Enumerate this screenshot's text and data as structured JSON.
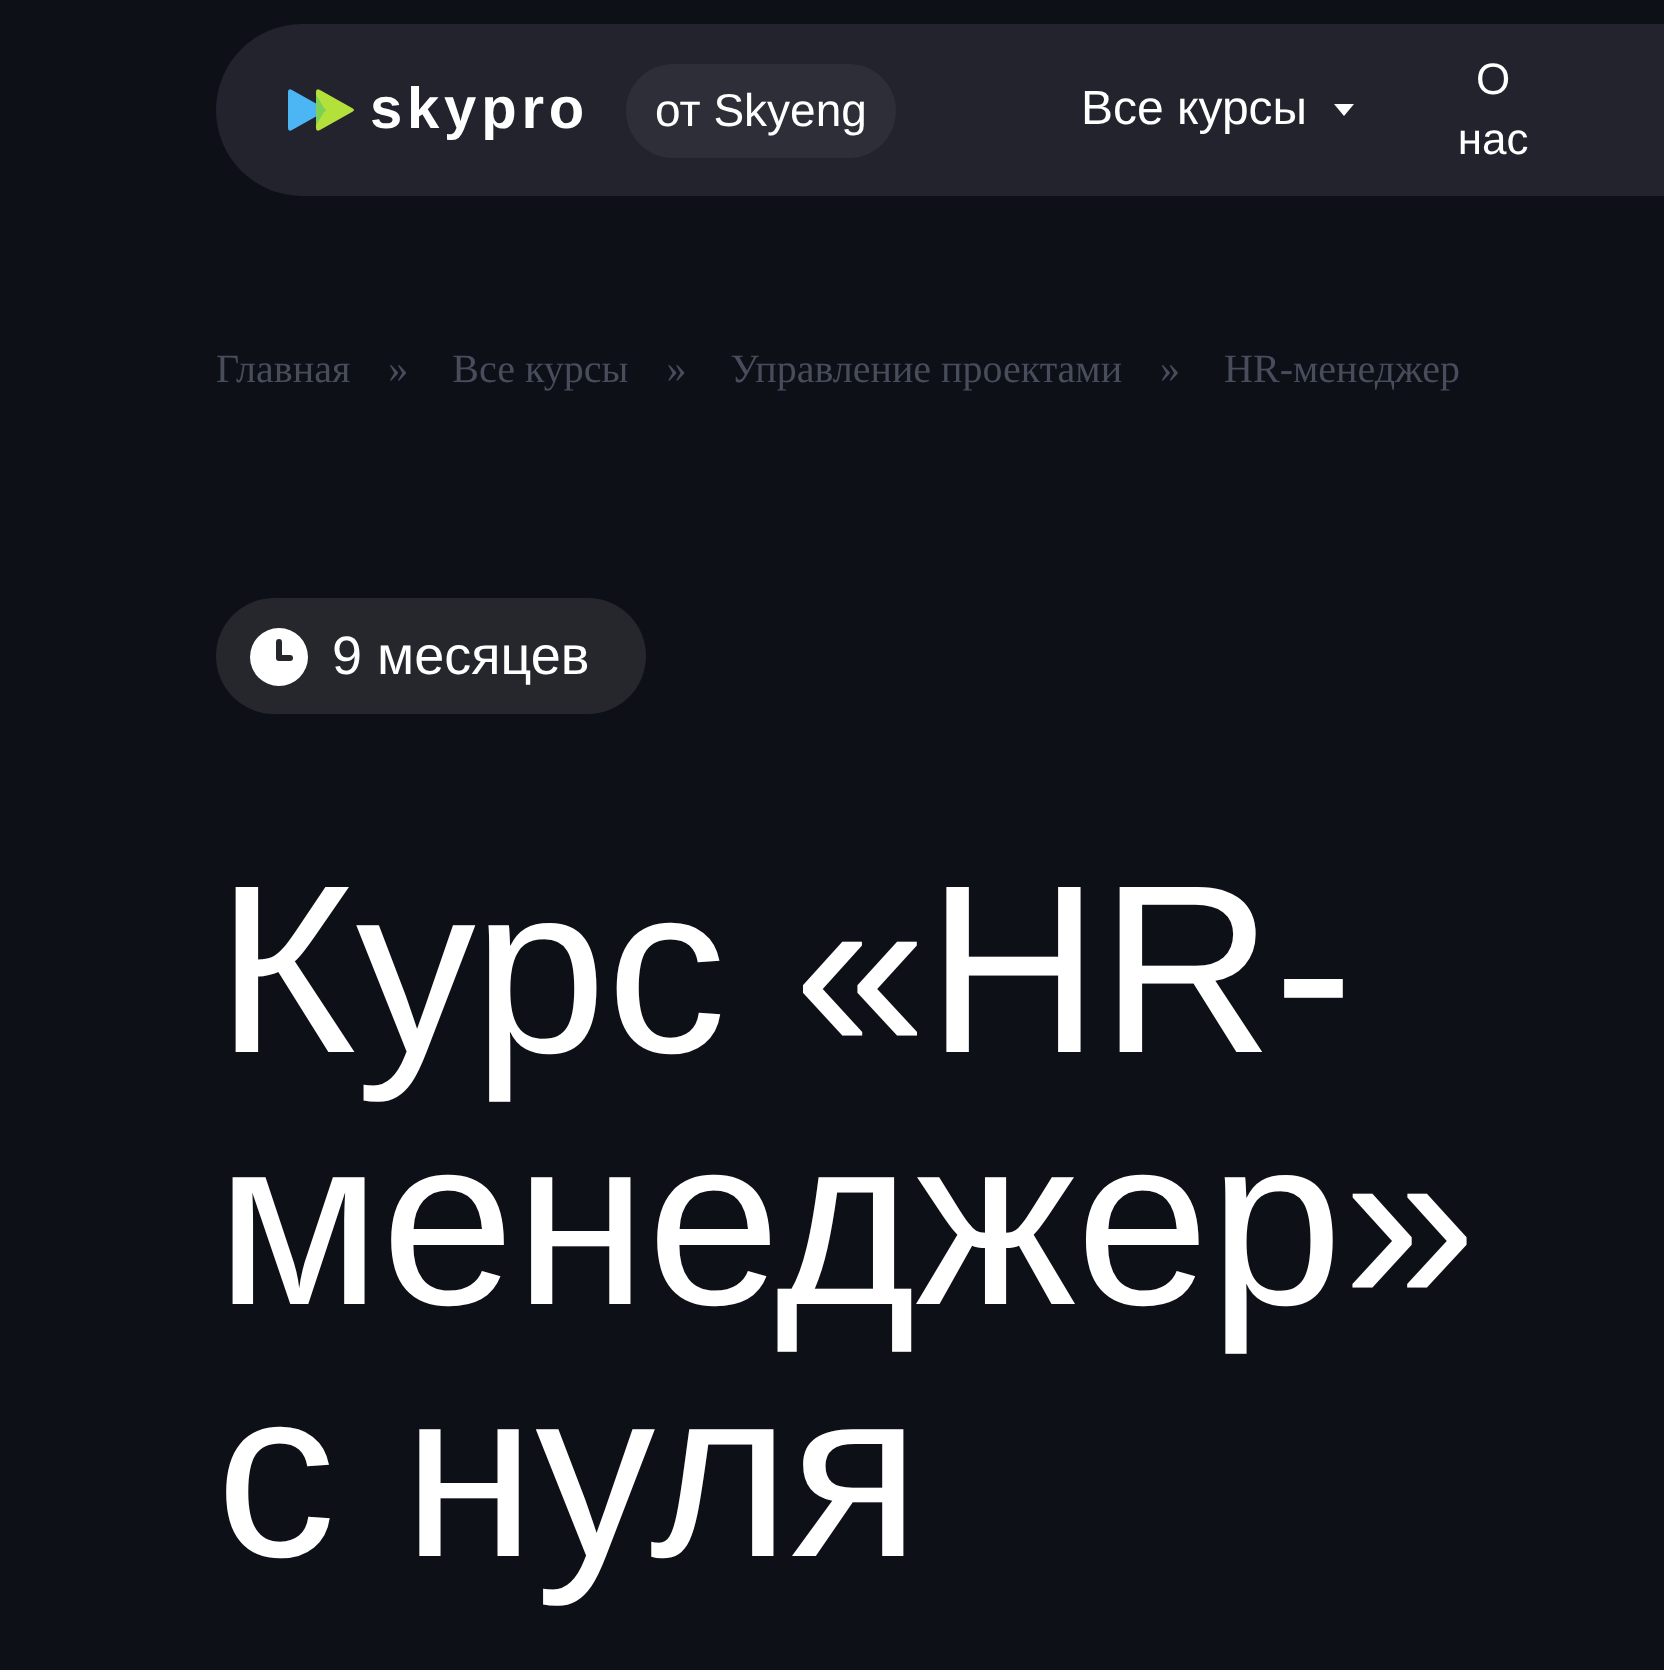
{
  "header": {
    "logo": {
      "text": "skypro"
    },
    "tagline": "от Skyeng",
    "nav": [
      {
        "kind": "dropdown",
        "label": "Все курсы"
      },
      {
        "kind": "link",
        "label": "О нас"
      }
    ]
  },
  "breadcrumbs": [
    {
      "label": "Главная",
      "separator": "»"
    },
    {
      "label": "Все курсы",
      "separator": "»"
    },
    {
      "label": "Управление проектами",
      "separator": "»"
    },
    {
      "label": "HR-менеджер"
    }
  ],
  "duration": {
    "text": "9 месяцев"
  },
  "title": "Курс «HR-менеджер» с нуля"
}
